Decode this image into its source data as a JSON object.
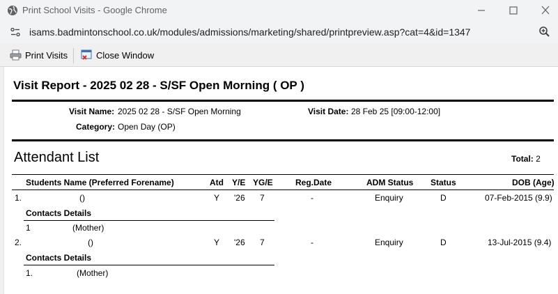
{
  "window": {
    "title": "Print School Visits - Google Chrome"
  },
  "address": {
    "url": "isams.badmintonschool.co.uk/modules/admissions/marketing/shared/printpreview.asp?cat=4&id=1347"
  },
  "toolbar": {
    "print_label": "Print Visits",
    "close_label": "Close Window"
  },
  "report": {
    "title": "Visit Report - 2025 02 28 - S/SF Open Morning ( OP )",
    "visit_name_label": "Visit Name:",
    "visit_name": "2025 02 28 - S/SF Open Morning",
    "visit_date_label": "Visit Date:",
    "visit_date": "28 Feb 25 [09:00-12:00]",
    "category_label": "Category:",
    "category": "Open Day (OP)"
  },
  "attendants": {
    "title": "Attendant List",
    "total_label": "Total:",
    "total": "2",
    "headers": {
      "name": "Students Name (Preferred Forename)",
      "atd": "Atd",
      "ye": "Y/E",
      "yge": "YG/E",
      "reg_date": "Reg.Date",
      "adm_status": "ADM Status",
      "status": "Status",
      "dob": "DOB (Age)"
    },
    "rows": [
      {
        "num": "1.",
        "name": "()",
        "atd": "Y",
        "ye": "'26",
        "yge": "7",
        "reg_date": "-",
        "adm_status": "Enquiry",
        "status": "D",
        "dob": "07-Feb-2015 (9.9)",
        "contacts_label": "Contacts Details",
        "contact_num": "1",
        "contact_rel": "(Mother)"
      },
      {
        "num": "2.",
        "name": "()",
        "atd": "Y",
        "ye": "'26",
        "yge": "7",
        "reg_date": "-",
        "adm_status": "Enquiry",
        "status": "D",
        "dob": "13-Jul-2015 (9.4)",
        "contacts_label": "Contacts Details",
        "contact_num": "1.",
        "contact_rel": "(Mother)"
      }
    ]
  }
}
